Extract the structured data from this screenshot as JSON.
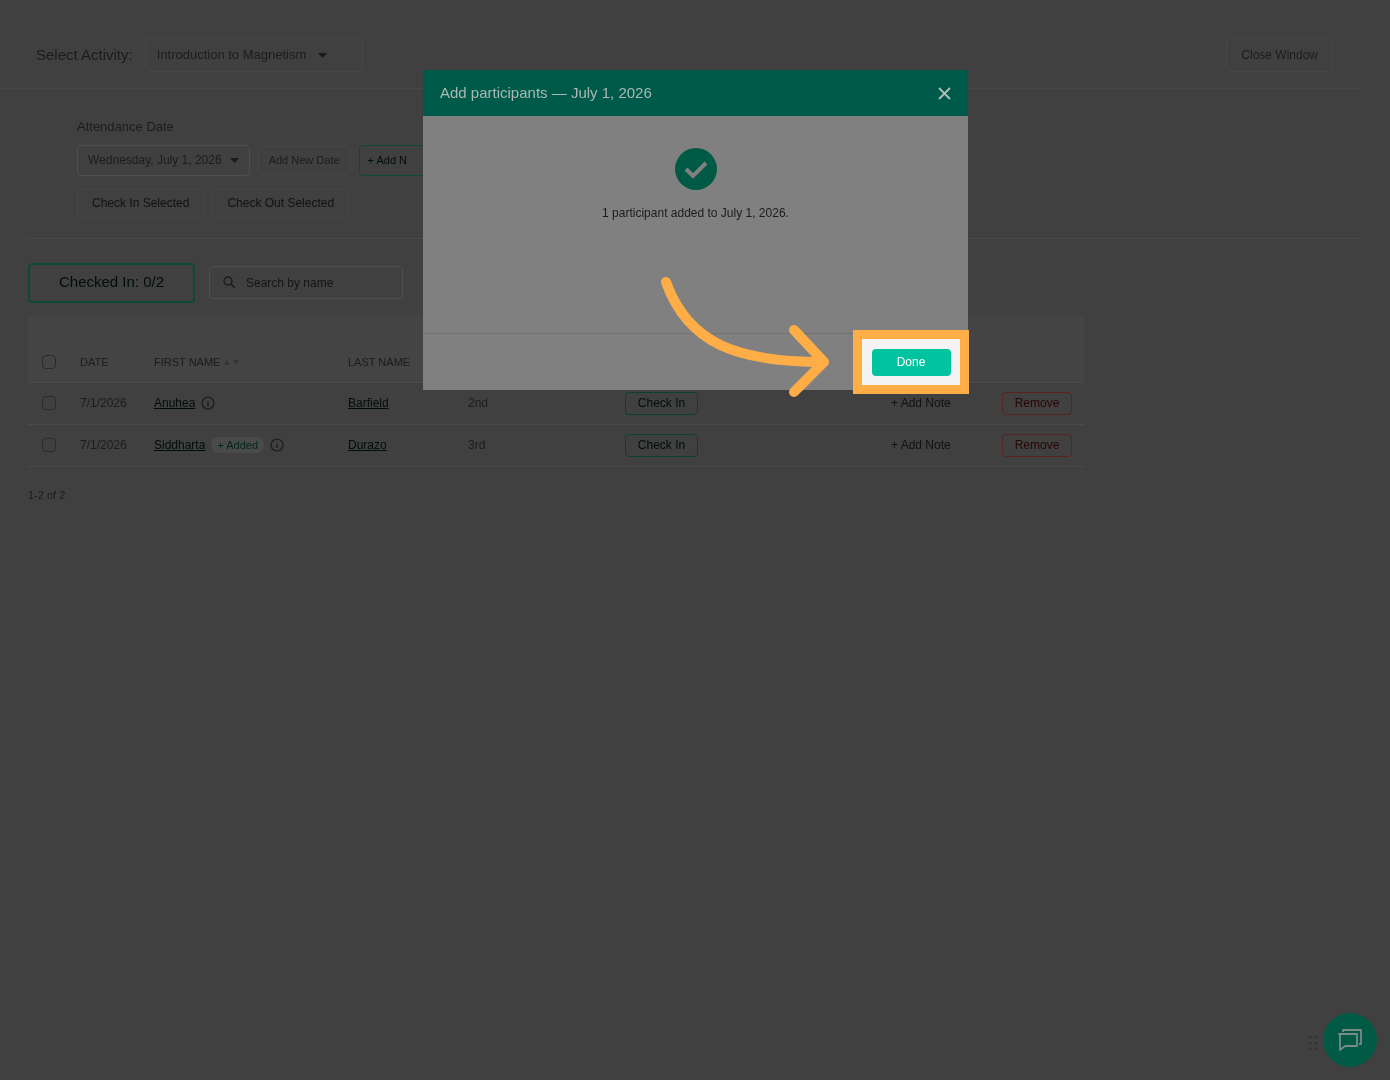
{
  "activity": {
    "label": "Select Activity:",
    "value": "Introduction to Magnetism"
  },
  "close_button": "Close Window",
  "attendance": {
    "label": "Attendance Date",
    "date": "Wednesday, July 1, 2026",
    "add_date": "Add New Date",
    "add_participant": "+ Add N",
    "check_in_selected": "Check In Selected",
    "check_out_selected": "Check Out Selected"
  },
  "checked_in": "Checked In: 0/2",
  "search": {
    "placeholder": "Search by name"
  },
  "table": {
    "select_all": {
      "checked": false
    },
    "columns": [
      "DATE",
      "FIRST NAME",
      "LAST NAME"
    ],
    "rows": [
      {
        "checked": false,
        "date": "7/1/2026",
        "first_name": "Anuhea",
        "last_name": "Barfield",
        "grade": "2nd",
        "check_in": "Check In",
        "note": "+ Add Note",
        "remove": "Remove"
      },
      {
        "checked": false,
        "date": "7/1/2026",
        "first_name": "Siddharta",
        "badge": "+ Added",
        "last_name": "Durazo",
        "grade": "3rd",
        "check_in": "Check In",
        "note": "+ Add Note",
        "remove": "Remove"
      }
    ]
  },
  "pagination": "1-2 of 2",
  "modal": {
    "title": "Add participants — July 1, 2026",
    "message": "1 participant added to July 1, 2026.",
    "done": "Done"
  }
}
